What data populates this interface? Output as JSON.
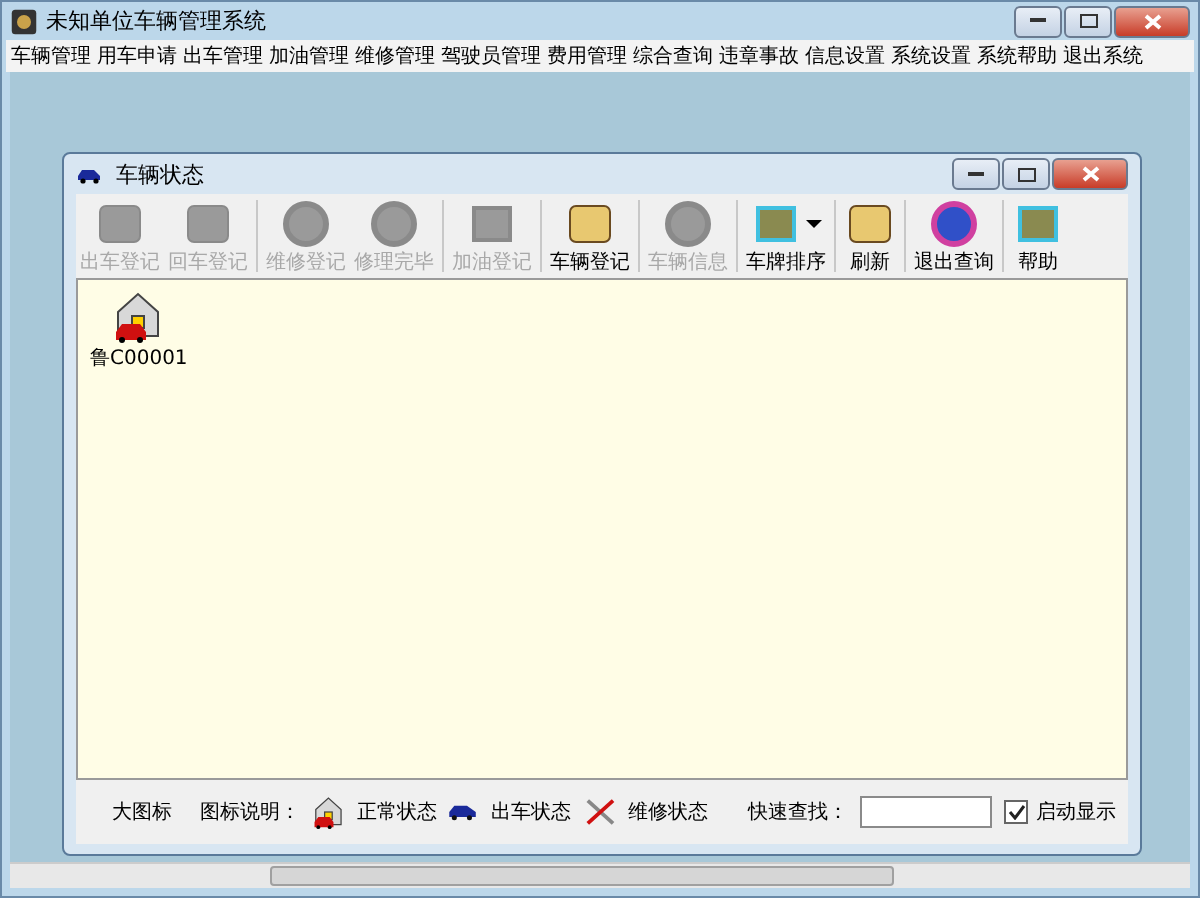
{
  "window": {
    "title": "未知单位车辆管理系统"
  },
  "menu": [
    "车辆管理",
    "用车申请",
    "出车管理",
    "加油管理",
    "维修管理",
    "驾驶员管理",
    "费用管理",
    "综合查询",
    "违章事故",
    "信息设置",
    "系统设置",
    "系统帮助",
    "退出系统"
  ],
  "child_window": {
    "title": "车辆状态"
  },
  "toolbar_groups": [
    [
      {
        "label": "出车登记",
        "disabled": true
      },
      {
        "label": "回车登记",
        "disabled": true
      }
    ],
    [
      {
        "label": "维修登记",
        "disabled": true
      },
      {
        "label": "修理完毕",
        "disabled": true
      }
    ],
    [
      {
        "label": "加油登记",
        "disabled": true
      }
    ],
    [
      {
        "label": "车辆登记",
        "disabled": false
      }
    ],
    [
      {
        "label": "车辆信息",
        "disabled": true
      }
    ],
    [
      {
        "label": "车牌排序",
        "disabled": false,
        "dropdown": true
      }
    ],
    [
      {
        "label": "刷新",
        "disabled": false
      }
    ],
    [
      {
        "label": "退出查询",
        "disabled": false
      }
    ],
    [
      {
        "label": "帮助",
        "disabled": false
      }
    ]
  ],
  "vehicles": [
    {
      "plate": "鲁C00001",
      "kind": "normal"
    }
  ],
  "bottom_bar": {
    "view_mode": "大图标",
    "legend_label": "图标说明：",
    "legend": [
      {
        "kind": "normal",
        "label": "正常状态"
      },
      {
        "kind": "out",
        "label": "出车状态"
      },
      {
        "kind": "repair",
        "label": "维修状态"
      }
    ],
    "search_label": "快速查找：",
    "checkbox": {
      "label": "启动显示",
      "checked": true
    }
  }
}
